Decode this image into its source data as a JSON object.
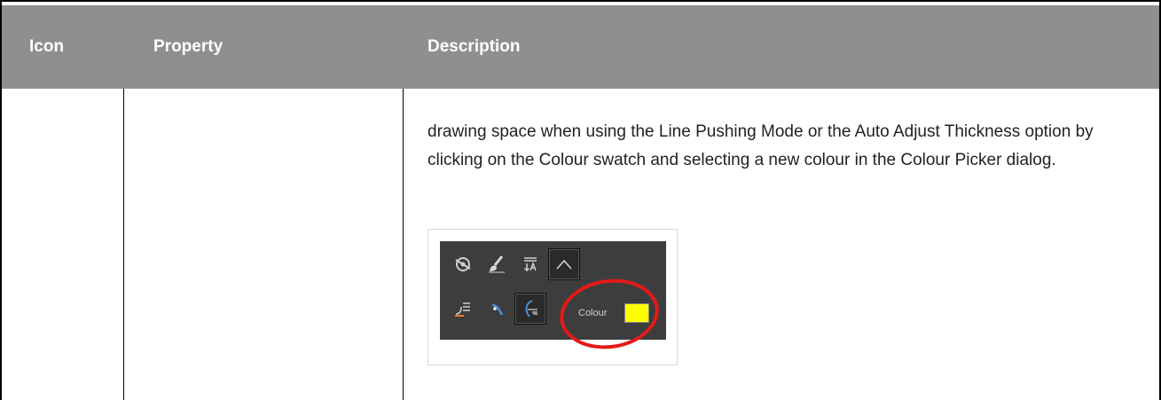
{
  "table": {
    "headers": {
      "icon": "Icon",
      "property": "Property",
      "description": "Description"
    },
    "row": {
      "description": "drawing space when using the Line Pushing Mode or the Auto Adjust Thickness option by clicking on the Colour swatch and selecting a new colour in the Colour Picker dialog."
    }
  },
  "screenshot": {
    "colour_label": "Colour",
    "swatch_color": "#ffff00",
    "highlight_color": "#e31a1a",
    "icons": [
      "rotate-lock-icon",
      "brush-smooth-icon",
      "text-align-icon",
      "caret-up-icon",
      "line-pushing-icon",
      "auto-adjust-icon",
      "line-thickness-icon"
    ]
  },
  "colors": {
    "header_bg": "#8e8f91",
    "toolbar_bg": "#3d3d3d"
  }
}
